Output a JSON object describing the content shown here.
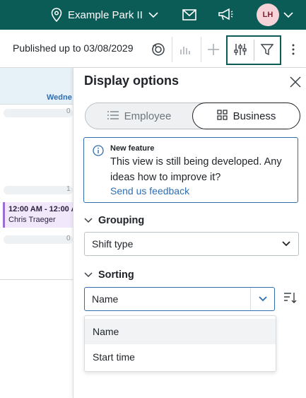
{
  "topbar": {
    "location_name": "Example Park II",
    "location_icon": "location-pin-icon",
    "mail_icon": "envelope-icon",
    "announce_icon": "megaphone-icon",
    "avatar_initials": "LH",
    "brand_color": "#0b5b57"
  },
  "toolbar": {
    "published_text": "Published up to 03/08/2029",
    "icons": [
      "publish-history-icon",
      "bar-chart-icon",
      "add-icon",
      "display-options-icon",
      "filter-icon",
      "more-vertical-icon"
    ]
  },
  "calendar": {
    "day_label": "Wedne",
    "counts": [
      "0",
      "1",
      "0"
    ],
    "shift": {
      "time": "12:00 AM - 12:00 A",
      "employee": "Chris Traeger"
    }
  },
  "panel": {
    "title": "Display options",
    "view_toggle": {
      "options": [
        "Employee",
        "Business"
      ],
      "selected": "Business"
    },
    "info": {
      "heading": "New feature",
      "body": "This view is still being developed. Any ideas how to improve it?",
      "link": "Send us feedback"
    },
    "grouping": {
      "label": "Grouping",
      "value": "Shift type"
    },
    "sorting": {
      "label": "Sorting",
      "value": "Name",
      "options": [
        "Name",
        "Start time"
      ]
    }
  }
}
